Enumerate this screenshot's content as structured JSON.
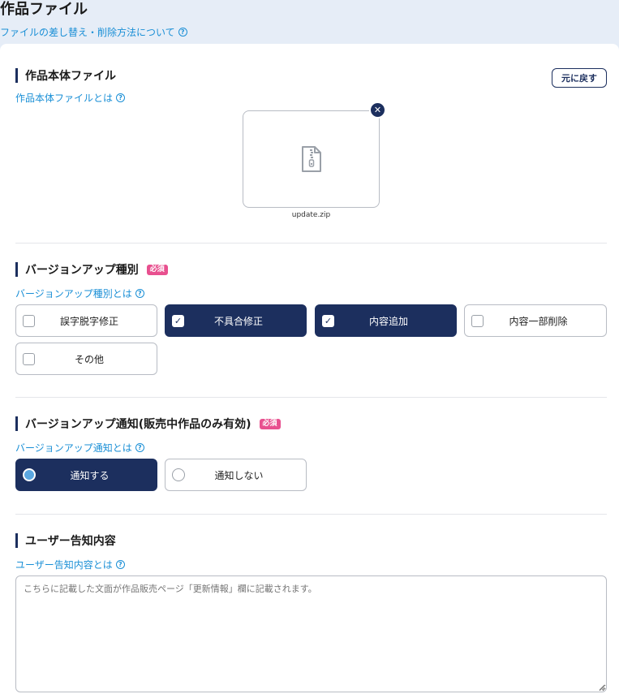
{
  "header": {
    "title": "作品ファイル",
    "help_link": "ファイルの差し替え・削除方法について"
  },
  "main_file": {
    "heading": "作品本体ファイル",
    "help_link": "作品本体ファイルとは",
    "revert_label": "元に戻す",
    "file_name": "update.zip",
    "file_icon": "zip-file-icon"
  },
  "version_type": {
    "heading": "バージョンアップ種別",
    "required": "必須",
    "help_link": "バージョンアップ種別とは",
    "options": [
      {
        "label": "誤字脱字修正",
        "checked": false
      },
      {
        "label": "不具合修正",
        "checked": true
      },
      {
        "label": "内容追加",
        "checked": true
      },
      {
        "label": "内容一部削除",
        "checked": false
      },
      {
        "label": "その他",
        "checked": false
      }
    ]
  },
  "version_notice": {
    "heading": "バージョンアップ通知(販売中作品のみ有効)",
    "required": "必須",
    "help_link": "バージョンアップ通知とは",
    "options": [
      {
        "label": "通知する",
        "selected": true
      },
      {
        "label": "通知しない",
        "selected": false
      }
    ]
  },
  "user_notice": {
    "heading": "ユーザー告知内容",
    "help_link": "ユーザー告知内容とは",
    "placeholder": "こちらに記載した文面が作品販売ページ「更新情報」欄に記載されます。"
  },
  "colors": {
    "accent": "#1c2f5e",
    "link": "#1a8fd6",
    "required": "#e8508f",
    "header_bg": "#e6edf7"
  }
}
